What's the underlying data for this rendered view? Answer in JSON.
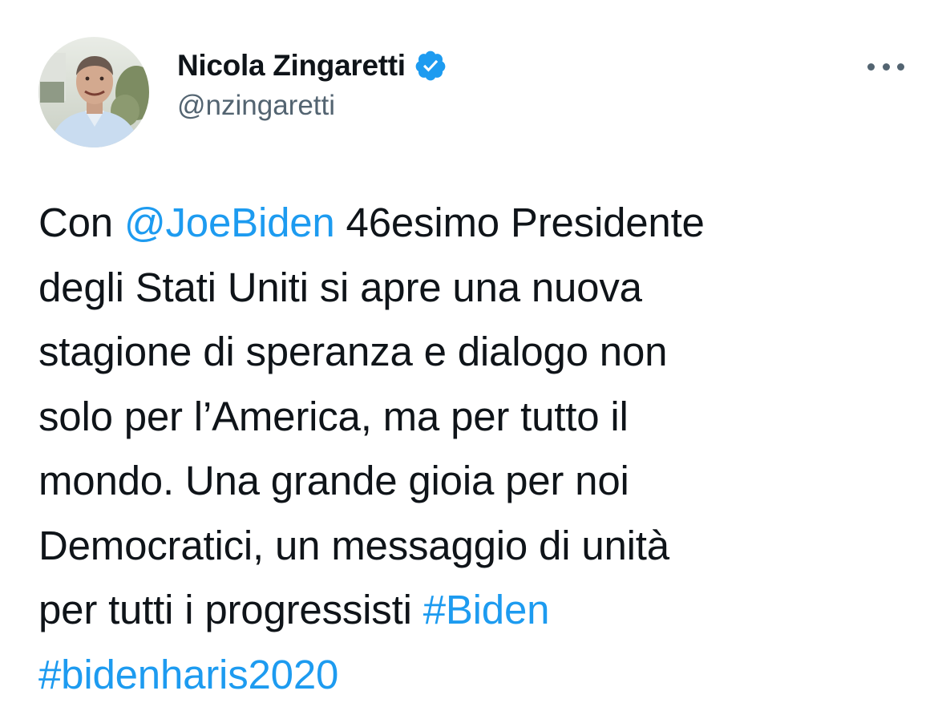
{
  "author": {
    "display_name": "Nicola Zingaretti",
    "handle": "@nzingaretti",
    "verified": true,
    "avatar_alt": "profile photo"
  },
  "tweet": {
    "lines": [
      [
        {
          "t": "Con ",
          "link": false
        },
        {
          "t": "@JoeBiden",
          "link": true
        },
        {
          "t": " 46esimo Presidente",
          "link": false
        }
      ],
      [
        {
          "t": "degli Stati Uniti si apre una nuova",
          "link": false
        }
      ],
      [
        {
          "t": "stagione di speranza e dialogo non",
          "link": false
        }
      ],
      [
        {
          "t": "solo per l’America, ma per tutto il",
          "link": false
        }
      ],
      [
        {
          "t": "mondo. Una grande gioia per noi",
          "link": false
        }
      ],
      [
        {
          "t": "Democratici, un messaggio di unità",
          "link": false
        }
      ],
      [
        {
          "t": "per tutti i progressisti ",
          "link": false
        },
        {
          "t": "#Biden",
          "link": true
        }
      ],
      [
        {
          "t": "#bidenharis2020",
          "link": true
        }
      ]
    ]
  },
  "icons": {
    "verified": "verified-badge-icon",
    "more": "more-options-icon"
  },
  "colors": {
    "text": "#0f1419",
    "secondary": "#536471",
    "link": "#1d9bf0",
    "background": "#ffffff"
  }
}
